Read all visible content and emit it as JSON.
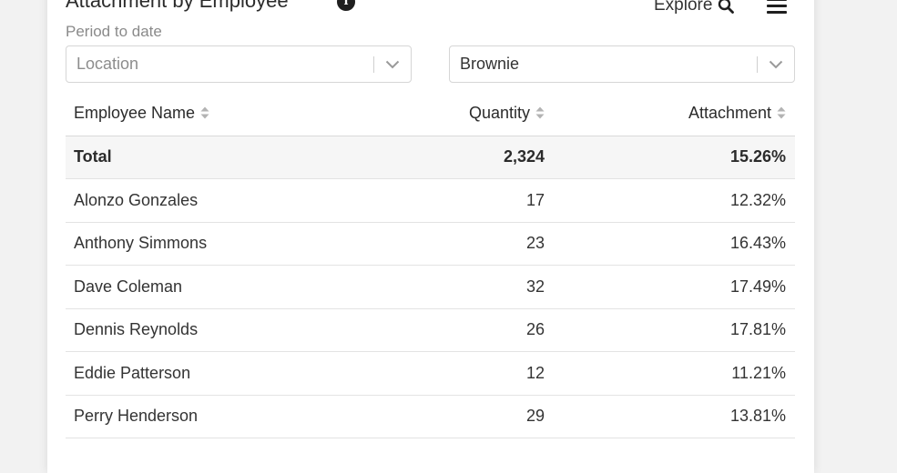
{
  "widget": {
    "title": "Attachment by Employee",
    "subtitle": "Period to date",
    "explore_label": "Explore"
  },
  "filters": {
    "location_placeholder": "Location",
    "product_value": "Brownie"
  },
  "table": {
    "columns": [
      "Employee Name",
      "Quantity",
      "Attachment"
    ],
    "total": {
      "name": "Total",
      "quantity": "2,324",
      "attachment": "15.26%"
    },
    "rows": [
      {
        "name": "Alonzo Gonzales",
        "quantity": "17",
        "attachment": "12.32%"
      },
      {
        "name": "Anthony Simmons",
        "quantity": "23",
        "attachment": "16.43%"
      },
      {
        "name": "Dave Coleman",
        "quantity": "32",
        "attachment": "17.49%"
      },
      {
        "name": "Dennis Reynolds",
        "quantity": "26",
        "attachment": "17.81%"
      },
      {
        "name": "Eddie Patterson",
        "quantity": "12",
        "attachment": "11.21%"
      },
      {
        "name": "Perry Henderson",
        "quantity": "29",
        "attachment": "13.81%"
      }
    ]
  },
  "icons": {
    "info": "info-icon",
    "search": "search-icon",
    "menu": "hamburger-menu-icon",
    "chevron": "chevron-down-icon",
    "sort": "sort-icon"
  },
  "colors": {
    "text": "#2b2b2b",
    "muted": "#8a8a8a",
    "border": "#d6d6d6",
    "total_row_bg": "#f6f6f6"
  }
}
